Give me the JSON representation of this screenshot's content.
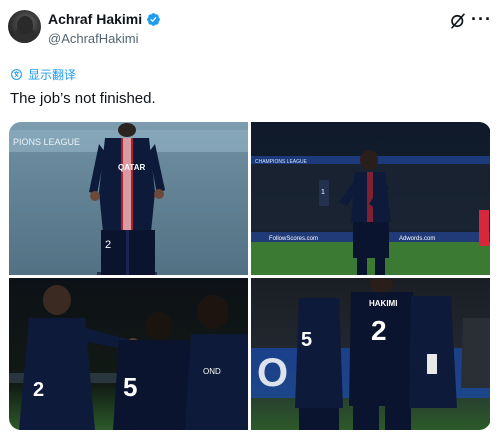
{
  "author": {
    "display_name": "Achraf Hakimi",
    "handle": "@AchrafHakimi",
    "verified": true
  },
  "translate_label": "显示翻译",
  "tweet_text": "The job’s not finished.",
  "icons": {
    "verified": "verified-badge-icon",
    "grok": "grok-icon",
    "more": "more-options-icon",
    "translate": "translate-icon"
  },
  "colors": {
    "accent": "#1d9bf0",
    "text": "#0f1419",
    "secondary_text": "#536471",
    "psg_navy": "#0e1a3a",
    "psg_red": "#d6283a"
  },
  "photos": [
    {
      "id": "photo-1",
      "banner_text": "PIONS LEAGUE",
      "shirt_text": "QATAR",
      "shirt_number": "2"
    },
    {
      "id": "photo-2",
      "banner_text": "CHAMPIONS LEAGUE",
      "board_text_1": "FollowScores.com",
      "board_text_2": "Adwords.com",
      "shirt_number": "1"
    },
    {
      "id": "photo-3",
      "shirt_number_front": "2",
      "shirt_number_back": "5",
      "sleeve_text": "OND"
    },
    {
      "id": "photo-4",
      "shirt_name": "HAKIMI",
      "shirt_number": "2",
      "shirt_number_side": "5",
      "board_text": "O"
    }
  ]
}
